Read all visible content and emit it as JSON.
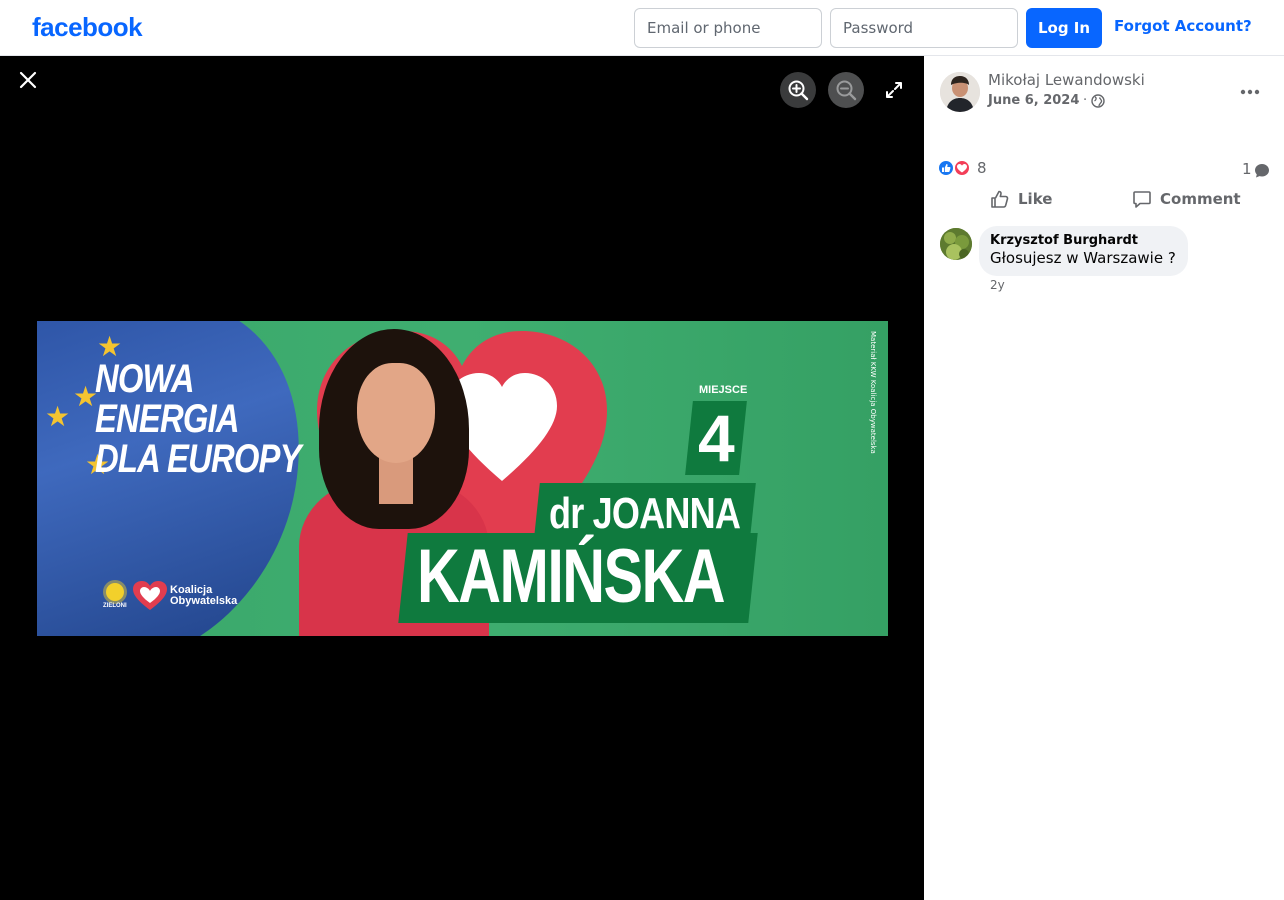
{
  "header": {
    "logo": "facebook",
    "email_placeholder": "Email or phone",
    "password_placeholder": "Password",
    "login_label": "Log In",
    "forgot_label": "Forgot Account?"
  },
  "viewer": {
    "icons": [
      "close-icon",
      "zoom-in-icon",
      "zoom-out-icon",
      "fullscreen-icon"
    ]
  },
  "poster": {
    "slogan": [
      "NOWA",
      "ENERGIA",
      "DLA EUROPY"
    ],
    "miejsce": "MIEJSCE",
    "number": "4",
    "name_first": "dr JOANNA",
    "name_last": "KAMIŃSKA",
    "side_text": "Materiał KKW Koalicja Obywatelska",
    "zieloni": "ZIELONI",
    "ko_line1": "Koalicja",
    "ko_line2": "Obywatelska"
  },
  "post": {
    "author": "Mikołaj Lewandowski",
    "date": "June 6, 2024",
    "separator": "·",
    "reaction_count": "8",
    "comment_count": "1",
    "like_label": "Like",
    "comment_label": "Comment"
  },
  "comments": [
    {
      "author": "Krzysztof Burghardt",
      "text": "Głosujesz w Warszawie ?",
      "time": "2y"
    }
  ],
  "colors": {
    "brand": "#0866ff",
    "poster_green": "#3fae70",
    "poster_dark_green": "#0f7a3e",
    "heart_red": "#e23d4f"
  }
}
